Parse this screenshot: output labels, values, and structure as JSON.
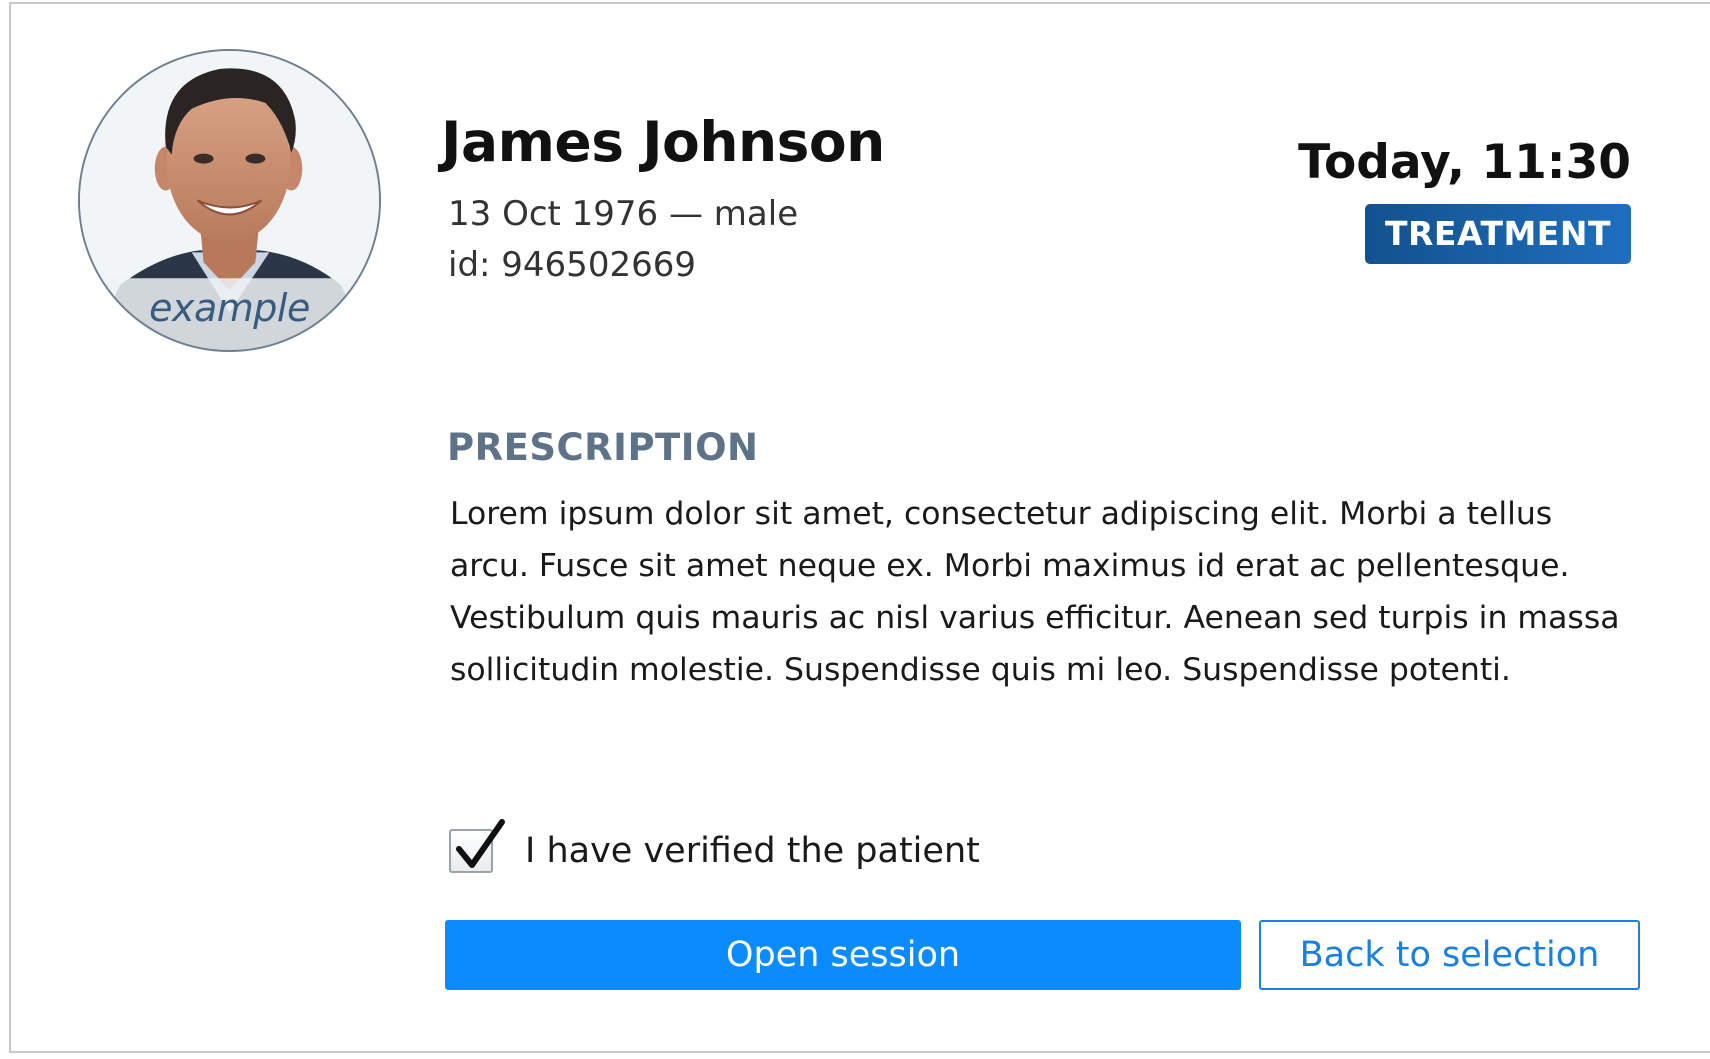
{
  "patient": {
    "name": "James Johnson",
    "dob_gender": "13 Oct 1976 — male",
    "id_line": "id: 946502669",
    "avatar_caption": "example"
  },
  "appointment": {
    "time": "Today, 11:30",
    "type_badge": "TREATMENT"
  },
  "prescription": {
    "title": "PRESCRIPTION",
    "text": "Lorem ipsum dolor sit amet, consectetur adipiscing elit. Morbi a tellus arcu. Fusce sit amet neque ex. Morbi maximus id erat ac pellentesque. Vestibulum quis mauris ac nisl varius efficitur. Aenean sed turpis in massa sollicitudin molestie. Suspendisse quis mi leo. Suspendisse potenti."
  },
  "verification": {
    "label": "I have verified the patient",
    "checked": true
  },
  "actions": {
    "open_session_label": "Open session",
    "back_label": "Back to selection"
  },
  "icons": {
    "avatar": "person-photo-icon",
    "checkmark": "checkmark-icon"
  },
  "colors": {
    "primary": "#0a8bff",
    "badge": "#1a64a8",
    "section_title": "#5e7388",
    "secondary_border": "#1b7fe0"
  }
}
